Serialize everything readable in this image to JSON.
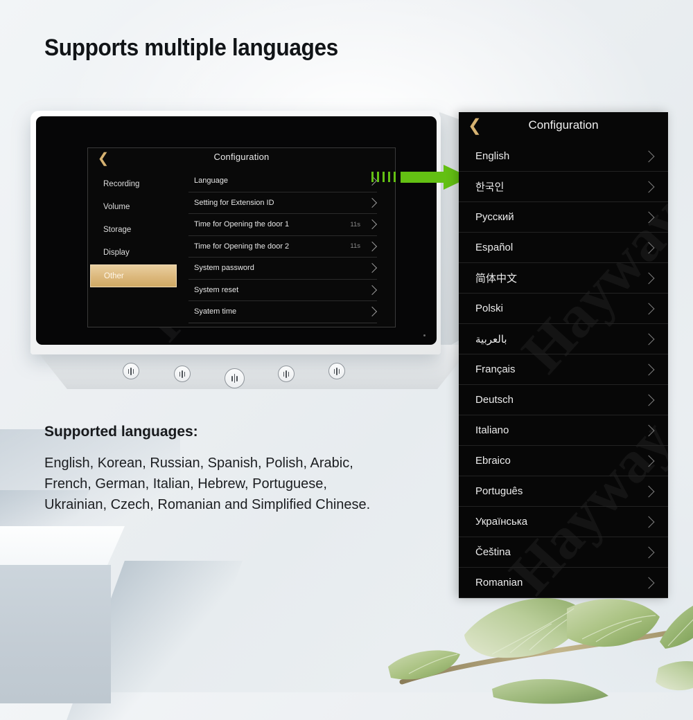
{
  "headline": "Supports multiple languages",
  "device": {
    "config": {
      "title": "Configuration",
      "back_icon": "chevron-left-icon",
      "sidebar": [
        {
          "label": "Recording",
          "active": false
        },
        {
          "label": "Volume",
          "active": false
        },
        {
          "label": "Storage",
          "active": false
        },
        {
          "label": "Display",
          "active": false
        },
        {
          "label": "Other",
          "active": true
        }
      ],
      "rows": [
        {
          "label": "Language",
          "value": ""
        },
        {
          "label": "Setting for Extension ID",
          "value": ""
        },
        {
          "label": "Time for Opening the door 1",
          "value": "11s"
        },
        {
          "label": "Time for Opening the door 2",
          "value": "11s"
        },
        {
          "label": "System  password",
          "value": ""
        },
        {
          "label": "System reset",
          "value": ""
        },
        {
          "label": "Syatem time",
          "value": ""
        }
      ]
    },
    "touch_buttons": [
      "touch-button-1",
      "touch-button-2",
      "touch-button-3",
      "touch-button-4",
      "touch-button-5"
    ],
    "watermark": "Hayway"
  },
  "arrow": {
    "name": "green-right-arrow",
    "color": "#63c013"
  },
  "language_panel": {
    "title": "Configuration",
    "back_icon": "chevron-left-icon",
    "watermark": "Hayway",
    "items": [
      {
        "label": "English",
        "rtl": false
      },
      {
        "label": "한국인",
        "rtl": false
      },
      {
        "label": "Русский",
        "rtl": false
      },
      {
        "label": "Español",
        "rtl": false
      },
      {
        "label": "简体中文",
        "rtl": false
      },
      {
        "label": "Polski",
        "rtl": false
      },
      {
        "label": "بالعربية",
        "rtl": true
      },
      {
        "label": "Français",
        "rtl": false
      },
      {
        "label": "Deutsch",
        "rtl": false
      },
      {
        "label": "Italiano",
        "rtl": false
      },
      {
        "label": "Ebraico",
        "rtl": false
      },
      {
        "label": "Português",
        "rtl": false
      },
      {
        "label": "Українська",
        "rtl": false
      },
      {
        "label": "Čeština",
        "rtl": false
      },
      {
        "label": "Romanian",
        "rtl": false
      }
    ]
  },
  "caption": {
    "heading": "Supported languages:",
    "line1": "English, Korean, Russian, Spanish, Polish, Arabic,",
    "line2": "French, German, Italian, Hebrew, Portuguese,",
    "line3": "Ukrainian, Czech, Romanian and Simplified Chinese."
  },
  "colors": {
    "accent_gold": "#dcb87c",
    "arrow_green": "#63c013",
    "screen_black": "#070707",
    "background": "#eceff2"
  }
}
